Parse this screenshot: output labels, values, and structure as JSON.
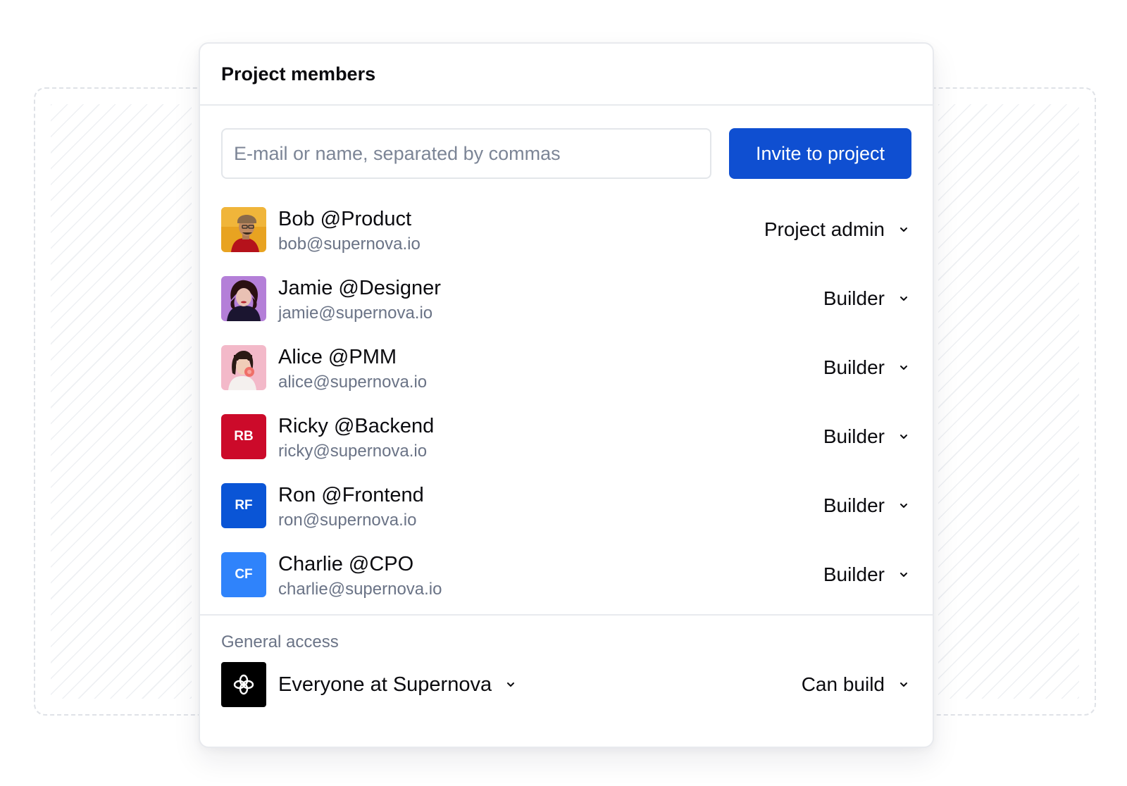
{
  "panel": {
    "title": "Project members"
  },
  "invite": {
    "placeholder": "E-mail or name, separated by commas",
    "value": "",
    "button_label": "Invite to project"
  },
  "members": [
    {
      "name": "Bob @Product",
      "email": "bob@supernova.io",
      "role": "Project admin",
      "avatar": {
        "type": "photo",
        "icon": "person-photo-yellow",
        "bg": "#e8a321"
      }
    },
    {
      "name": "Jamie @Designer",
      "email": "jamie@supernova.io",
      "role": "Builder",
      "avatar": {
        "type": "photo",
        "icon": "person-photo-purple",
        "bg": "#b47fd8"
      }
    },
    {
      "name": "Alice @PMM",
      "email": "alice@supernova.io",
      "role": "Builder",
      "avatar": {
        "type": "photo",
        "icon": "person-photo-pink",
        "bg": "#f3b9c9"
      }
    },
    {
      "name": "Ricky @Backend",
      "email": "ricky@supernova.io",
      "role": "Builder",
      "avatar": {
        "type": "initials",
        "initials": "RB",
        "bg": "#cc0a2a"
      }
    },
    {
      "name": "Ron @Frontend",
      "email": "ron@supernova.io",
      "role": "Builder",
      "avatar": {
        "type": "initials",
        "initials": "RF",
        "bg": "#0a55d6"
      }
    },
    {
      "name": "Charlie @CPO",
      "email": "charlie@supernova.io",
      "role": "Builder",
      "avatar": {
        "type": "initials",
        "initials": "CF",
        "bg": "#2f83fb"
      }
    }
  ],
  "general_access": {
    "label": "General access",
    "organization": "Everyone at Supernova",
    "permission": "Can build",
    "logo_icon": "supernova-logo-icon"
  },
  "colors": {
    "accent": "#0f4fd1",
    "muted_text": "#6a7386",
    "border": "#e8eaee"
  }
}
